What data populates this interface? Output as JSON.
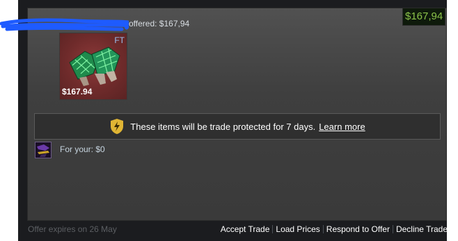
{
  "offer": {
    "offered_text": "offered: $167,94",
    "total_value": "$167,94"
  },
  "item": {
    "wear": "FT",
    "price": "$167.94",
    "icon": "gloves-icon"
  },
  "protection": {
    "icon": "trade-protection-shield-icon",
    "message": "These items will be trade protected for 7 days.",
    "link_label": "Learn more"
  },
  "your_side": {
    "label": "For your: $0"
  },
  "footer": {
    "expires": "Offer expires on 26 May",
    "actions": [
      "Accept Trade",
      "Load Prices",
      "Respond to Offer",
      "Decline Trade"
    ]
  },
  "colors": {
    "card_bg": "#3f3f3f",
    "price_green": "#8bc34a",
    "item_bg": "#6f2b2b",
    "shield": "#e0b534"
  }
}
